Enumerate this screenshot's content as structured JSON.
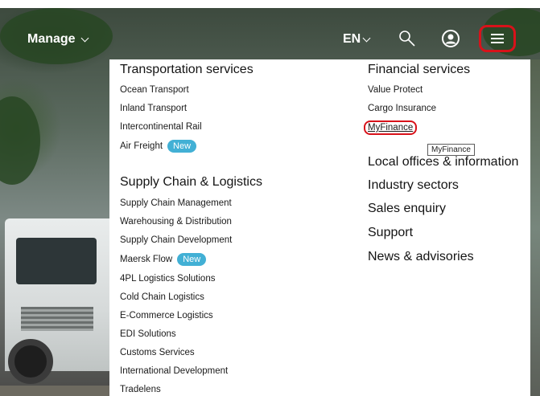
{
  "header": {
    "manage_label": "Manage",
    "lang_label": "EN",
    "menu_icon": "hamburger-icon",
    "search_icon": "search-icon",
    "user_icon": "user-icon",
    "highlight_color": "#d8121a"
  },
  "menu": {
    "transportation": {
      "title": "Transportation services",
      "items": [
        "Ocean Transport",
        "Inland Transport",
        "Intercontinental Rail",
        "Air Freight"
      ],
      "air_freight_badge": "New"
    },
    "supply_chain": {
      "title": "Supply Chain & Logistics",
      "items": [
        "Supply Chain Management",
        "Warehousing & Distribution",
        "Supply Chain Development",
        "Maersk Flow",
        "4PL Logistics Solutions",
        "Cold Chain Logistics",
        "E-Commerce Logistics",
        "EDI Solutions",
        "Customs Services",
        "International Development",
        "Tradelens"
      ],
      "maersk_flow_badge": "New"
    },
    "financial": {
      "title": "Financial services",
      "items": [
        "Value Protect",
        "Cargo Insurance",
        "MyFinance"
      ]
    },
    "more": [
      "Local offices & information",
      "Industry sectors",
      "Sales enquiry",
      "Support",
      "News & advisories"
    ],
    "tooltip": "MyFinance",
    "badge_color": "#42b0d5"
  }
}
